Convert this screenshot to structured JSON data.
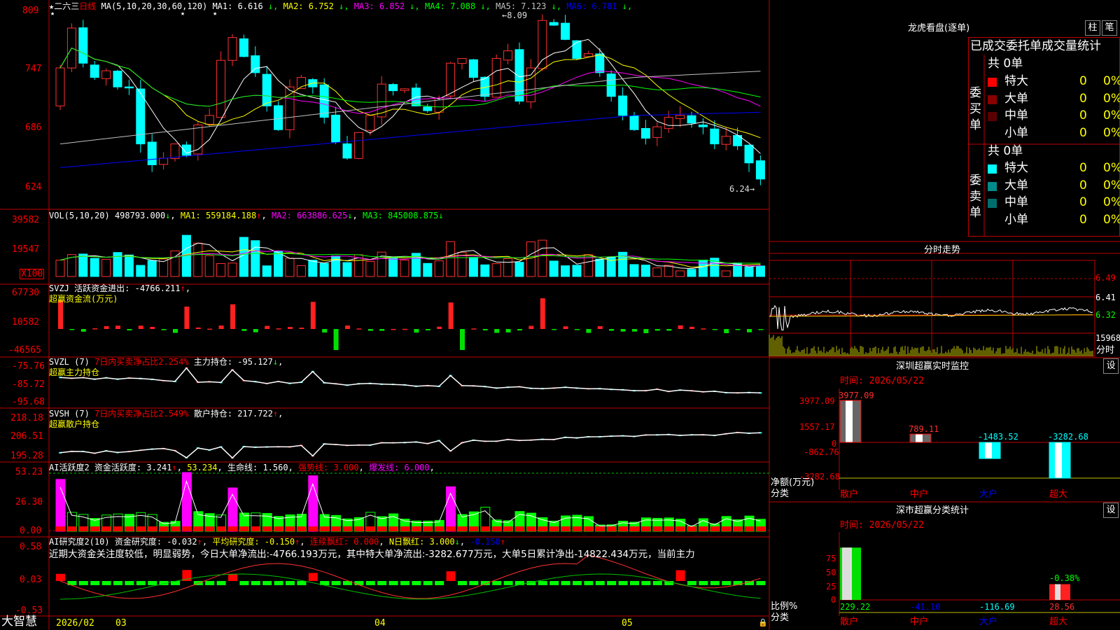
{
  "stock": {
    "name": "二六三",
    "period": "日线",
    "ma_title": "MA(5,10,20,30,60,120)"
  },
  "ma": [
    {
      "label": "MA1: 6.616",
      "arrow": "↓",
      "color": "#ffffff"
    },
    {
      "label": "MA2: 6.752",
      "arrow": "↓",
      "color": "#ffff00"
    },
    {
      "label": "MA3: 6.852",
      "arrow": "↓",
      "color": "#ff00ff"
    },
    {
      "label": "MA4: 7.088",
      "arrow": "↓",
      "color": "#00ff00"
    },
    {
      "label": "MA5: 7.123",
      "arrow": "↓",
      "color": "#c0c0c0"
    },
    {
      "label": "MA6: 6.781",
      "arrow": "↓",
      "color": "#0000ff"
    }
  ],
  "price_axis": [
    "809",
    "747",
    "686",
    "624"
  ],
  "price_notes": {
    "high": "8.09",
    "low": "6.24"
  },
  "vol": {
    "title": "VOL(5,10,20)",
    "value": "498793.000",
    "arrow": "↓",
    "ma1": "MA1: 559184.188",
    "ma1_arrow": "↑",
    "ma2": "MA2: 663886.625",
    "ma2_arrow": "↓",
    "ma3": "MA3: 845008.875",
    "ma3_arrow": "↓",
    "axis": [
      "39582",
      "19547"
    ],
    "unit": "X100"
  },
  "svzj": {
    "title": "SVZJ",
    "label": "活跃资金进出: -4766.211",
    "arrow": "↑",
    "sub": "超赢资金流(万元)",
    "axis": [
      "67730",
      "10582",
      "-46565"
    ]
  },
  "svzl": {
    "title": "SVZL (7)",
    "label": "7日内买卖净占比2.254%",
    "label2": "主力持仓: -95.127",
    "arrow": "↓",
    "sub": "超赢主力持仓",
    "axis": [
      "-75.76",
      "-85.72",
      "-95.68"
    ]
  },
  "svsh": {
    "title": "SVSH (7)",
    "label": "7日内买卖净占比2.549%",
    "label2": "散户持仓: 217.722",
    "arrow": "↑",
    "sub": "超赢散户持仓",
    "axis": [
      "218.18",
      "206.51",
      "195.28"
    ]
  },
  "ai1": {
    "title": "AI活跃度2",
    "a": "资金活跃度: 3.241",
    "a_arrow": "↑",
    "b": "53.234",
    "c": "生命线: 1.560",
    "d": "强势线: 3.000",
    "e": "爆发线: 6.000",
    "axis": [
      "53.23",
      "26.30",
      "0.00"
    ]
  },
  "ai2": {
    "title": "AI研究度2(10)",
    "a": "资金研究度: -0.032",
    "a_arrow": "↑",
    "b": "平均研究度: -0.150",
    "b_arrow": "↑",
    "c": "连续飘红: 0.000",
    "d": "N日飘红: 3.000",
    "d_arrow": "↓",
    "e": "-0.150",
    "e_arrow": "↑",
    "text": "近期大资金关注度较低，明显弱势，今日大单净流出:-4766.193万元，其中特大单净流出:-3282.677万元，大单5日累计净出-14822.434万元，当前主力",
    "axis": [
      "0.58",
      "0.03",
      "-0.53"
    ]
  },
  "bottom": {
    "brand": "大智慧",
    "dates": [
      "2026/02",
      "03",
      "04",
      "05"
    ]
  },
  "longhu": {
    "title": "龙虎看盘(逐单)",
    "btn1": "柱",
    "btn2": "笔",
    "header": "已成交委托单成交量统计",
    "buy": {
      "label": "委买单",
      "total": "共 0单",
      "rows": [
        {
          "name": "特大",
          "v": "0",
          "p": "0%",
          "color": "#ff0000"
        },
        {
          "name": "大单",
          "v": "0",
          "p": "0%",
          "color": "#8b0000"
        },
        {
          "name": "中单",
          "v": "0",
          "p": "0%",
          "color": "#5a0000"
        },
        {
          "name": "小单",
          "v": "0",
          "p": "0%",
          "color": ""
        }
      ]
    },
    "sell": {
      "label": "委卖单",
      "total": "共 0单",
      "rows": [
        {
          "name": "特大",
          "v": "0",
          "p": "0%",
          "color": "#00ffff"
        },
        {
          "name": "大单",
          "v": "0",
          "p": "0%",
          "color": "#008b8b"
        },
        {
          "name": "中单",
          "v": "0",
          "p": "0%",
          "color": "#006d6d"
        },
        {
          "name": "小单",
          "v": "0",
          "p": "0%",
          "color": ""
        }
      ]
    }
  },
  "intraday": {
    "title": "分时走势",
    "axis": [
      "6.49",
      "6.41",
      "6.32"
    ],
    "vol_label": "15968",
    "vol_unit": "分时"
  },
  "monitor": {
    "title": "深圳超赢实时监控",
    "btn": "设",
    "time": "时间: 2026/05/22",
    "axis": [
      "3977.09",
      "1557.17",
      "0",
      "-862.76",
      "-3282.68"
    ],
    "ylabel": "净额(万元)",
    "xlabel": "分类",
    "categories": [
      "散户",
      "中户",
      "大户",
      "超大"
    ],
    "values": [
      3977.09,
      789.11,
      -1483.52,
      -3282.68
    ],
    "value_labels": [
      "3977.09",
      "789.11",
      "-1483.52",
      "-3282.68"
    ]
  },
  "classify": {
    "title": "深市超赢分类统计",
    "btn": "设",
    "time": "时间: 2026/05/22",
    "axis": [
      "75",
      "50",
      "25",
      "0"
    ],
    "ylabel": "比例%",
    "xlabel": "分类",
    "categories": [
      "散户",
      "中户",
      "大户",
      "超大"
    ],
    "values": [
      229.22,
      -41.1,
      -116.69,
      28.56
    ],
    "value_labels": [
      "229.22",
      "-41.10",
      "-116.69",
      "28.56"
    ],
    "annotation": "-0.38%"
  },
  "chart_data": [
    {
      "type": "bar",
      "title": "深圳超赢实时监控",
      "ylabel": "净额(万元)",
      "xlabel": "分类",
      "categories": [
        "散户",
        "中户",
        "大户",
        "超大"
      ],
      "values": [
        3977.09,
        789.11,
        -1483.52,
        -3282.68
      ],
      "ylim": [
        -3282.68,
        3977.09
      ]
    },
    {
      "type": "bar",
      "title": "深市超赢分类统计",
      "ylabel": "比例%",
      "xlabel": "分类",
      "categories": [
        "散户",
        "中户",
        "大户",
        "超大"
      ],
      "values": [
        229.22,
        -41.1,
        -116.69,
        28.56
      ],
      "ylim": [
        0,
        75
      ]
    }
  ]
}
